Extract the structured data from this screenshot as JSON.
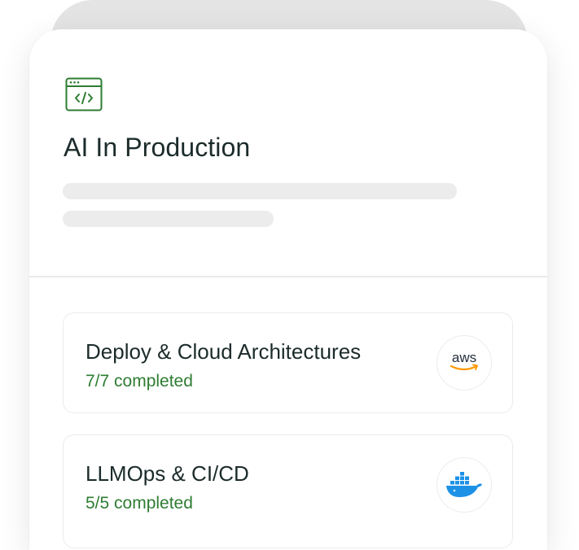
{
  "course": {
    "icon": "code-window-icon",
    "title": "AI In Production"
  },
  "modules": [
    {
      "title": "Deploy & Cloud Architectures",
      "progress": "7/7 completed",
      "logo": "aws-logo",
      "logo_text": "aws"
    },
    {
      "title": "LLMOps & CI/CD",
      "progress": "5/5 completed",
      "logo": "docker-logo"
    }
  ],
  "colors": {
    "accent_green": "#2e7d32",
    "title_text": "#1c2b2b",
    "skeleton": "#ececec",
    "aws_orange": "#ff9900",
    "docker_blue": "#1d91e6"
  }
}
